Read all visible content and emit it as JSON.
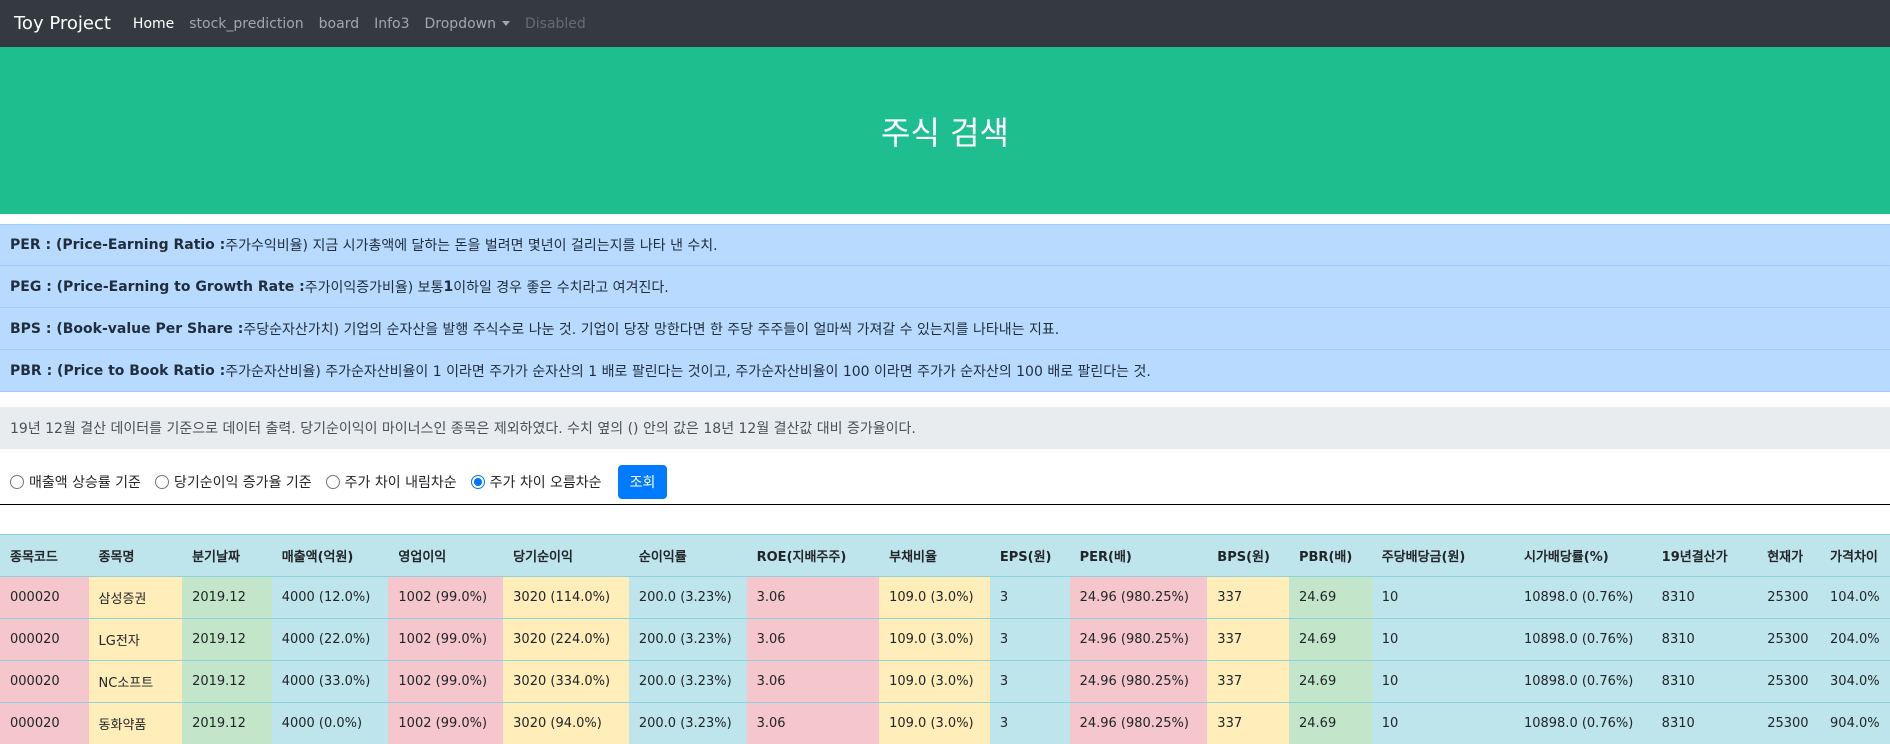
{
  "navbar": {
    "brand": "Toy Project",
    "links": [
      "Home",
      "stock_prediction",
      "board",
      "Info3"
    ],
    "dropdown": "Dropdown",
    "disabled": "Disabled"
  },
  "hero": {
    "title": "주식 검색"
  },
  "info_rows": [
    {
      "term": "PER : (Price-Earning Ratio :",
      "text": " 주가수익비율) 지금 시가총액에 달하는 돈을 벌려면 몇년이 걸리는지를 나타 낸 수치."
    },
    {
      "term": "PEG : (Price-Earning to Growth Rate :",
      "text": " 주가이익증가비율) 보통 ",
      "num": "1",
      "tail": " 이하일 경우 좋은 수치라고 여겨진다."
    },
    {
      "term": "BPS : (Book-value Per Share :",
      "text": " 주당순자산가치) 기업의 순자산을 발행 주식수로 나눈 것. 기업이 당장 망한다면 한 주당 주주들이 얼마씩 가져갈 수 있는지를 나타내는 지표."
    },
    {
      "term": "PBR : (Price to Book Ratio :",
      "text": " 주가순자산비율) 주가순자산비율이 1 이라면 주가가 순자산의 1 배로 팔린다는 것이고, 주가순자산비율이 100 이라면 주가가 순자산의 100 배로 팔린다는 것."
    }
  ],
  "note": "19년 12월 결산 데이터를 기준으로 데이터 출력. 당기순이익이 마이너스인 종목은 제외하였다. 수치 옆의 () 안의 값은 18년 12월 결산값 대비 증가율이다.",
  "controls": {
    "options": [
      "매출액 상승률 기준",
      "당기순이익 증가율 기준",
      "주가 차이 내림차순",
      "주가 차이 오름차순"
    ],
    "selected_index": 3,
    "submit_label": "조회"
  },
  "table": {
    "headers": [
      "종목코드",
      "종목명",
      "분기날짜",
      "매출액(억원)",
      "영업이익",
      "당기순이익",
      "순이익률",
      "ROE(지배주주)",
      "부채비율",
      "EPS(원)",
      "PER(배)",
      "BPS(원)",
      "PBR(배)",
      "주당배당금(원)",
      "시가배당률(%)",
      "19년결산가",
      "현재가",
      "가격차이"
    ],
    "rows": [
      [
        "000020",
        "삼성증권",
        "2019.12",
        "4000 (12.0%)",
        "1002 (99.0%)",
        "3020 (114.0%)",
        "200.0 (3.23%)",
        "3.06",
        "109.0 (3.0%)",
        "3",
        "24.96 (980.25%)",
        "337",
        "24.69",
        "10",
        "10898.0 (0.76%)",
        "8310",
        "25300",
        "104.0%"
      ],
      [
        "000020",
        "LG전자",
        "2019.12",
        "4000 (22.0%)",
        "1002 (99.0%)",
        "3020 (224.0%)",
        "200.0 (3.23%)",
        "3.06",
        "109.0 (3.0%)",
        "3",
        "24.96 (980.25%)",
        "337",
        "24.69",
        "10",
        "10898.0 (0.76%)",
        "8310",
        "25300",
        "204.0%"
      ],
      [
        "000020",
        "NC소프트",
        "2019.12",
        "4000 (33.0%)",
        "1002 (99.0%)",
        "3020 (334.0%)",
        "200.0 (3.23%)",
        "3.06",
        "109.0 (3.0%)",
        "3",
        "24.96 (980.25%)",
        "337",
        "24.69",
        "10",
        "10898.0 (0.76%)",
        "8310",
        "25300",
        "304.0%"
      ],
      [
        "000020",
        "동화약품",
        "2019.12",
        "4000 (0.0%)",
        "1002 (99.0%)",
        "3020 (94.0%)",
        "200.0 (3.23%)",
        "3.06",
        "109.0 (3.0%)",
        "3",
        "24.96 (980.25%)",
        "337",
        "24.69",
        "10",
        "10898.0 (0.76%)",
        "8310",
        "25300",
        "904.0%"
      ]
    ]
  }
}
